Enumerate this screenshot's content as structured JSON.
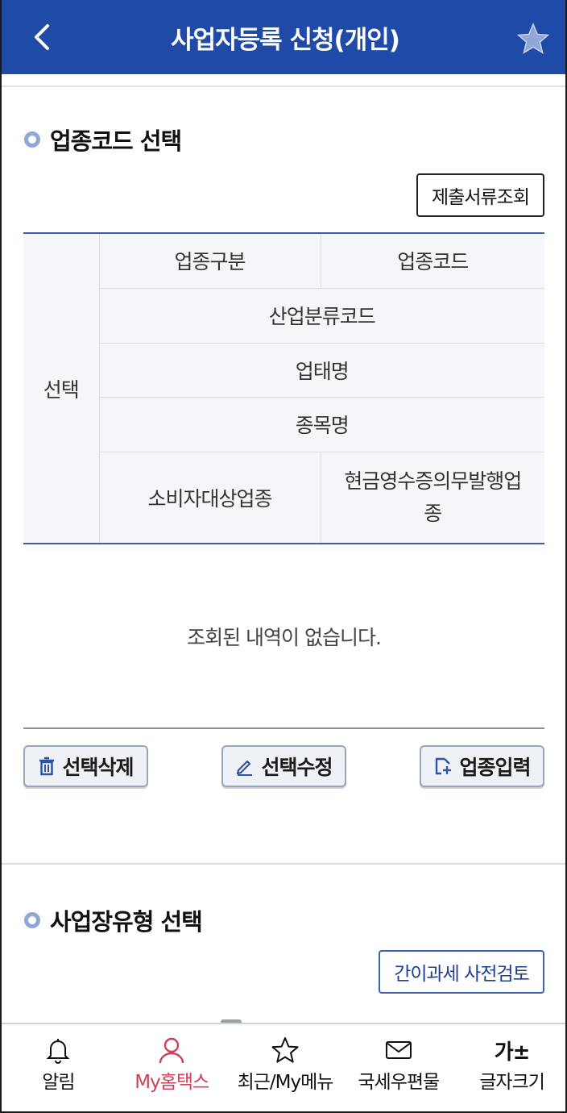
{
  "header": {
    "title": "사업자등록 신청(개인)",
    "back_icon": "chevron-left-icon",
    "favorite_icon": "star-icon"
  },
  "industry_section": {
    "title": "업종코드 선택",
    "docs_button": "제출서류조회",
    "table": {
      "select_header": "선택",
      "col_type": "업종구분",
      "col_code": "업종코드",
      "col_industry_class": "산업분류코드",
      "col_business_type": "업태명",
      "col_item": "종목명",
      "col_consumer": "소비자대상업종",
      "col_cash_receipt": "현금영수증의무발행업종"
    },
    "empty_message": "조회된 내역이 없습니다.",
    "actions": {
      "delete": "선택삭제",
      "edit": "선택수정",
      "input": "업종입력"
    }
  },
  "workplace_section": {
    "title": "사업장유형 선택",
    "review_button": "간이과세 사전검토"
  },
  "bottom_nav": [
    {
      "label": "알림",
      "icon": "bell-icon",
      "active": false
    },
    {
      "label": "My홈택스",
      "icon": "person-icon",
      "active": true
    },
    {
      "label": "최근/My메뉴",
      "icon": "star-outline-icon",
      "active": false
    },
    {
      "label": "국세우편물",
      "icon": "mail-icon",
      "active": false
    },
    {
      "label": "글자크기",
      "icon": "text-size-icon",
      "glyph": "가±",
      "active": false
    }
  ],
  "colors": {
    "header_blue": "#1f4aa8",
    "active_nav": "#d0405a",
    "table_border": "#3d5fa8"
  }
}
